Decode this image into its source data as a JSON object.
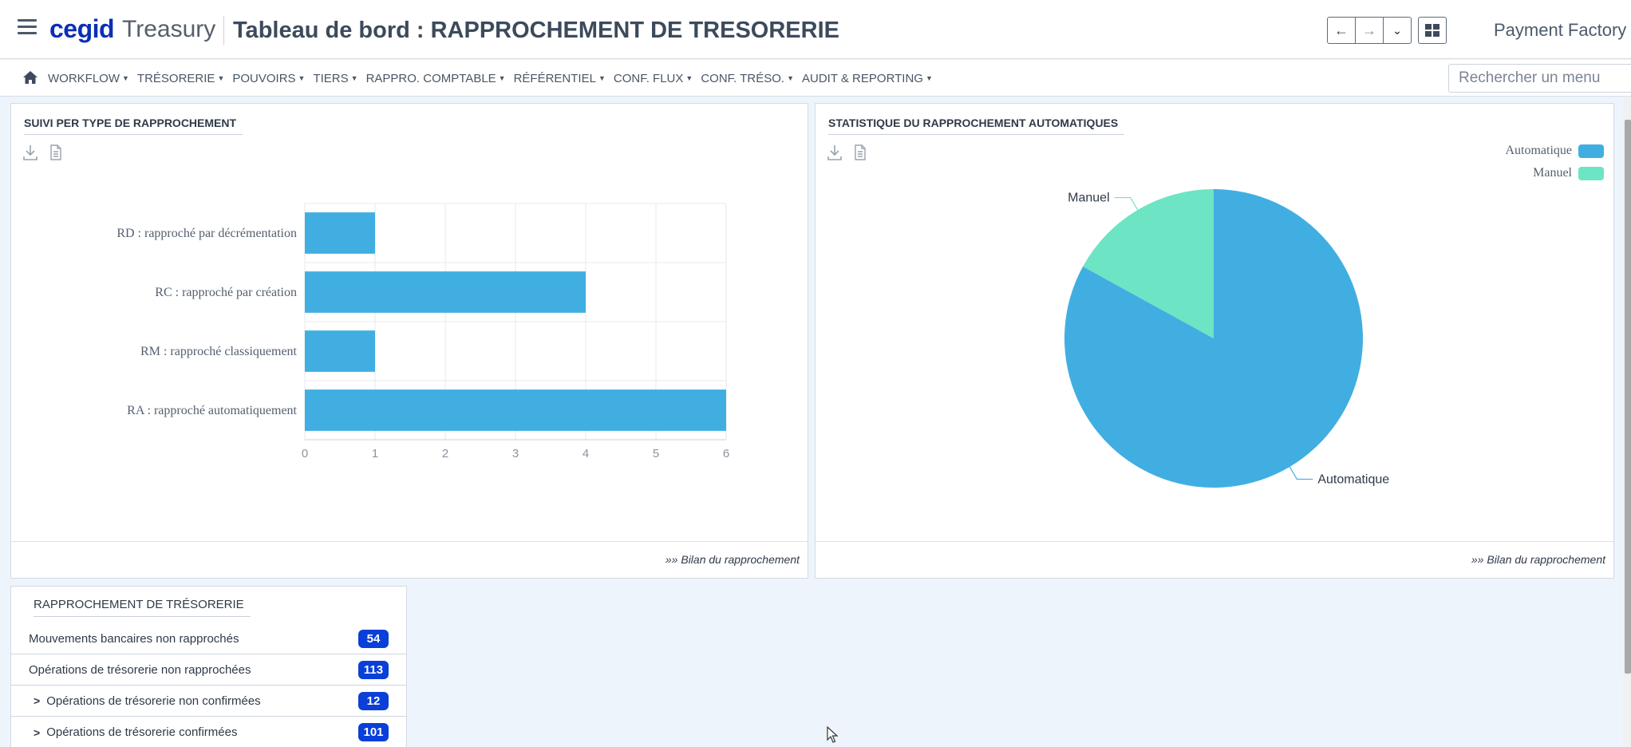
{
  "header": {
    "logo": "cegid",
    "product": "Treasury",
    "title": "Tableau de bord : ",
    "title_sub": "RAPPROCHEMENT DE TRESORERIE",
    "back_label": "←",
    "forward_label": "→",
    "dropdown_label": "⌄",
    "payment_factory": "Payment Factory"
  },
  "menubar": {
    "items": [
      {
        "label": "WORKFLOW"
      },
      {
        "label": "TRÉSORERIE"
      },
      {
        "label": "POUVOIRS"
      },
      {
        "label": "TIERS"
      },
      {
        "label": "RAPPRO. COMPTABLE"
      },
      {
        "label": "RÉFÉRENTIEL"
      },
      {
        "label": "CONF. FLUX"
      },
      {
        "label": "CONF. TRÉSO."
      },
      {
        "label": "AUDIT & REPORTING"
      }
    ],
    "search_placeholder": "Rechercher un menu"
  },
  "panels": {
    "suivi": {
      "title": "SUIVI PER TYPE DE RAPPROCHEMENT",
      "footer_link": "»» Bilan du rapprochement"
    },
    "stats": {
      "title": "STATISTIQUE DU RAPPROCHEMENT AUTOMATIQUES",
      "footer_link": "»» Bilan du rapprochement"
    },
    "treso": {
      "title": "RAPPROCHEMENT DE TRÉSORERIE",
      "rows": [
        {
          "label": "Mouvements bancaires non rapprochés",
          "count": "54"
        },
        {
          "label": "Opérations de trésorerie non rapprochées",
          "count": "113"
        },
        {
          "label": "Opérations de trésorerie non confirmées",
          "count": "12"
        },
        {
          "label": "Opérations de trésorerie confirmées",
          "count": "101"
        }
      ]
    }
  },
  "chart_data": [
    {
      "type": "bar",
      "orientation": "horizontal",
      "categories": [
        "RD : rapproché par décrémentation",
        "RC : rapproché par création",
        "RM : rapproché classiquement",
        "RA : rapproché automatiquement"
      ],
      "values": [
        1,
        4,
        1,
        6
      ],
      "xlim": [
        0,
        6
      ],
      "xticks": [
        "0",
        "1",
        "2",
        "3",
        "4",
        "5",
        "6"
      ],
      "grid": true,
      "color": "#41aee2"
    },
    {
      "type": "pie",
      "labels": [
        "Automatique",
        "Manuel"
      ],
      "values": [
        83,
        17
      ],
      "colors": [
        "#41aee2",
        "#6de4c3"
      ],
      "legend": "top-right"
    }
  ]
}
